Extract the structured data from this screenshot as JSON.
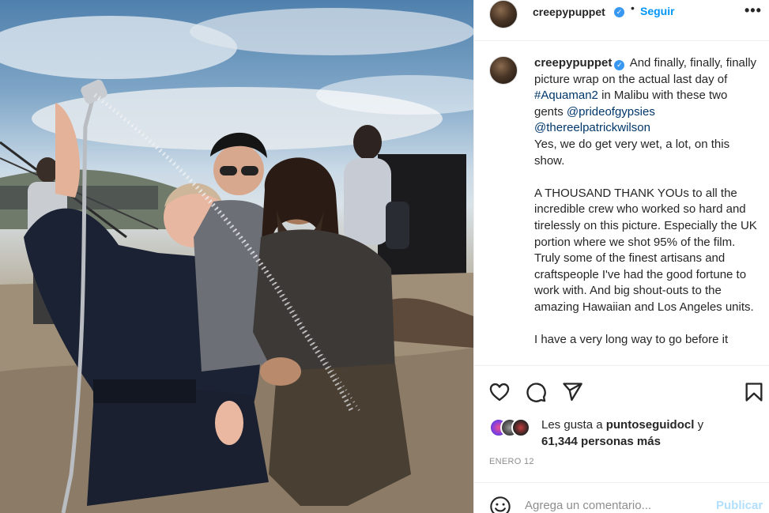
{
  "photo": {
    "alt_icon": "photo-image"
  },
  "header": {
    "username": "creepypuppet",
    "verified_glyph": "✓",
    "separator": "•",
    "follow_label": "Seguir",
    "more_label": "•••"
  },
  "caption": {
    "username": "creepypuppet",
    "verified_glyph": "✓",
    "line1_text": "And finally, finally, finally picture wrap on the actual last day of",
    "hashtag": "#Aquaman2",
    "line1_after": "in Malibu with these two gents",
    "mention1": "@prideofgypsies",
    "mention2": "@thereelpatrickwilson",
    "line2": "Yes, we do get very wet, a lot, on this show.",
    "para2": "A THOUSAND THANK YOUs to all the incredible crew who worked so hard and tirelessly on this picture. Especially the UK portion where we shot 95% of the film. Truly some of the finest artisans and craftspeople I've had the good fortune to work with. And big shout-outs to the amazing Hawaiian and Los Angeles units.",
    "para3": "I have a very long way to go before it"
  },
  "actions": {
    "icons": [
      "heart-icon",
      "comment-icon",
      "share-icon",
      "bookmark-icon"
    ]
  },
  "likes": {
    "prefix": "Les gusta a",
    "user": "puntoseguidocl",
    "conj": "y",
    "count": "61,344 personas más"
  },
  "date": "ENERO 12",
  "comment": {
    "placeholder": "Agrega un comentario...",
    "publish_label": "Publicar"
  },
  "colors": {
    "accent": "#0095f6",
    "verified": "#3897f0",
    "link": "#00376b",
    "publish_disabled": "#b2dffc",
    "muted": "#8e8e8e"
  }
}
